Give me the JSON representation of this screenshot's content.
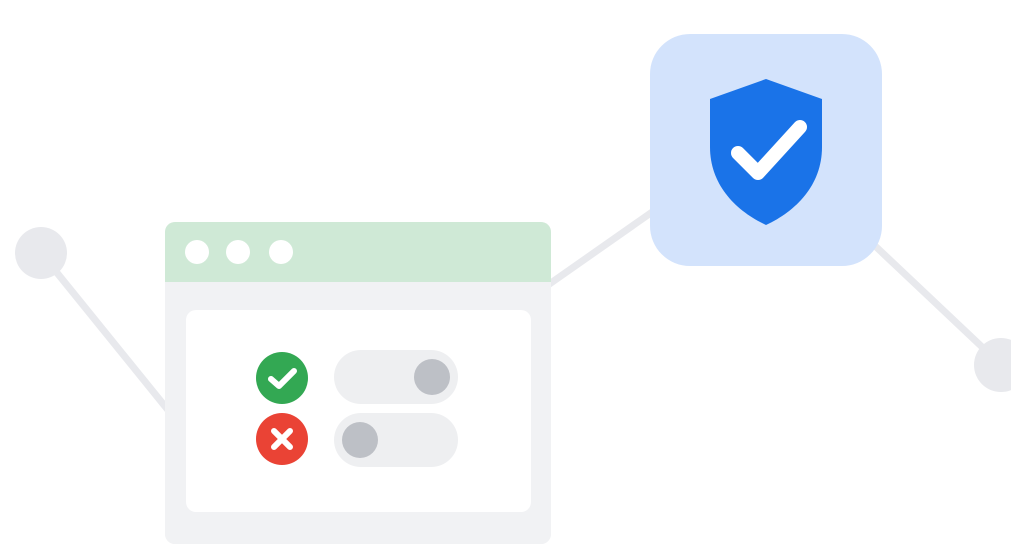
{
  "colors": {
    "background": "#ffffff",
    "line": "#e8e9ed",
    "node": "#e8e9ed",
    "window_titlebar": "#cfe9d6",
    "window_body": "#f1f2f4",
    "panel": "#ffffff",
    "check_green": "#33a853",
    "error_red": "#ea4335",
    "toggle_track": "#eeeff1",
    "toggle_knob": "#bdc0c6",
    "tile": "#d3e3fc",
    "shield_blue": "#1a73e8",
    "mark_white": "#ffffff"
  },
  "icons": {
    "shield": "shield-check-icon",
    "success": "check-circle-icon",
    "error": "x-circle-icon"
  },
  "toggles": {
    "first": {
      "state": "on"
    },
    "second": {
      "state": "off"
    }
  },
  "window_controls": {
    "count": 3
  }
}
